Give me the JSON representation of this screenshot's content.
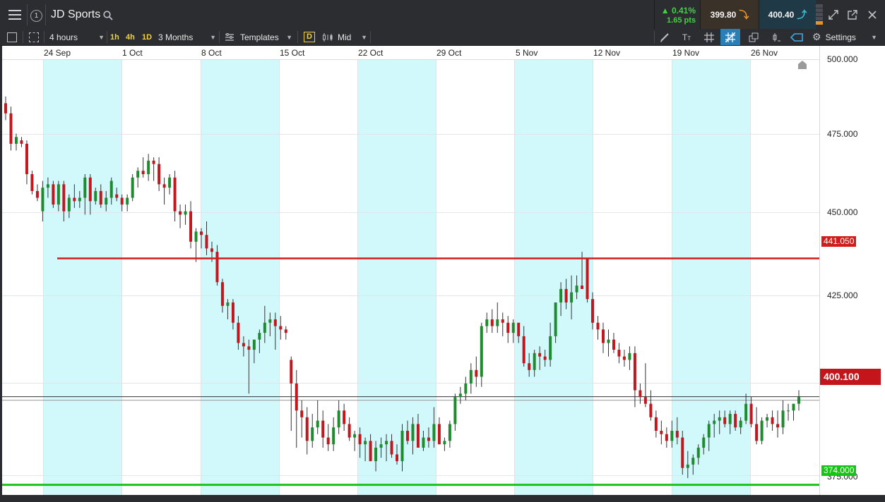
{
  "header": {
    "window_number": "1",
    "title": "JD Sports",
    "change_pct": "▲ 0.41%",
    "change_pts": "1.65 pts",
    "sell_price": "399.80",
    "buy_price": "400.40"
  },
  "toolbar": {
    "interval": "4 hours",
    "quick_intervals": [
      "1h",
      "4h",
      "1D"
    ],
    "range": "3 Months",
    "templates": "Templates",
    "d_badge": "D",
    "price_mode": "Mid",
    "settings": "Settings"
  },
  "chart": {
    "x_labels": [
      "24 Sep",
      "1 Oct",
      "8 Oct",
      "15 Oct",
      "22 Oct",
      "29 Oct",
      "5 Nov",
      "12 Nov",
      "19 Nov",
      "26 Nov"
    ],
    "y_labels": [
      "500.000",
      "475.000",
      "450.000",
      "425.000",
      "375.000"
    ],
    "y_label_values": [
      500,
      475,
      450,
      425,
      375
    ],
    "resistance_label": "441.050",
    "resistance_value": 441.05,
    "support_label": "374.000",
    "support_value": 374.0,
    "current_label": "400.100",
    "current_value": 400.1,
    "colors": {
      "resistance": "#d21b1b",
      "support": "#16c416",
      "up_candle": "#1e8c2e",
      "down_candle": "#c0181e",
      "shade": "#d1f8fb"
    }
  },
  "chart_data": {
    "type": "candlestick",
    "title": "JD Sports",
    "interval": "4 hours",
    "ylim": [
      371,
      504
    ],
    "candles": [
      [
        487,
        489,
        482,
        484
      ],
      [
        484,
        486,
        473,
        475
      ],
      [
        475,
        478,
        473,
        477
      ],
      [
        476,
        477,
        474,
        475
      ],
      [
        475,
        476,
        463,
        466
      ],
      [
        466,
        467,
        460,
        461
      ],
      [
        461,
        463,
        458,
        459
      ],
      [
        455,
        464,
        452,
        462
      ],
      [
        462,
        465,
        459,
        463
      ],
      [
        463,
        464,
        456,
        457
      ],
      [
        457,
        464,
        455,
        463
      ],
      [
        463,
        464,
        452,
        455
      ],
      [
        455,
        460,
        453,
        459
      ],
      [
        459,
        463,
        456,
        458
      ],
      [
        458,
        461,
        456,
        459
      ],
      [
        459,
        466,
        454,
        465
      ],
      [
        465,
        466,
        454,
        458
      ],
      [
        458,
        462,
        457,
        461
      ],
      [
        461,
        463,
        456,
        457
      ],
      [
        457,
        461,
        455,
        459
      ],
      [
        459,
        465,
        457,
        464
      ],
      [
        460,
        462,
        458,
        459
      ],
      [
        459,
        460,
        455,
        457
      ],
      [
        457,
        460,
        455,
        459
      ],
      [
        459,
        466,
        458,
        465
      ],
      [
        465,
        468,
        462,
        467
      ],
      [
        467,
        471,
        465,
        466
      ],
      [
        466,
        472,
        464,
        470
      ],
      [
        470,
        471,
        464,
        469
      ],
      [
        469,
        471,
        461,
        463
      ],
      [
        463,
        465,
        457,
        462
      ],
      [
        462,
        466,
        460,
        465
      ],
      [
        465,
        467,
        452,
        455
      ],
      [
        455,
        457,
        450,
        454
      ],
      [
        454,
        457,
        451,
        455
      ],
      [
        455,
        458,
        444,
        446
      ],
      [
        446,
        450,
        440,
        449
      ],
      [
        449,
        450,
        444,
        448
      ],
      [
        448,
        452,
        442,
        444
      ],
      [
        444,
        446,
        440,
        443
      ],
      [
        443,
        445,
        433,
        434
      ],
      [
        434,
        435,
        425,
        427
      ],
      [
        427,
        429,
        423,
        428
      ],
      [
        428,
        429,
        420,
        422
      ],
      [
        422,
        424,
        414,
        416
      ],
      [
        416,
        418,
        412,
        415
      ],
      [
        415,
        417,
        401,
        414
      ],
      [
        414,
        416,
        410,
        417
      ],
      [
        417,
        420,
        413,
        419
      ],
      [
        419,
        427,
        416,
        422
      ],
      [
        422,
        425,
        418,
        423
      ],
      [
        423,
        425,
        414,
        421
      ],
      [
        421,
        424,
        417,
        420
      ],
      [
        420,
        421,
        417,
        419
      ],
      [
        411,
        412,
        390,
        404
      ],
      [
        404,
        408,
        385,
        396
      ],
      [
        396,
        399,
        388,
        394
      ],
      [
        394,
        397,
        383,
        387
      ],
      [
        387,
        395,
        385,
        391
      ],
      [
        391,
        399,
        389,
        393
      ],
      [
        393,
        396,
        385,
        388
      ],
      [
        388,
        392,
        384,
        386
      ],
      [
        386,
        394,
        384,
        391
      ],
      [
        391,
        399,
        389,
        396
      ],
      [
        396,
        398,
        390,
        392
      ],
      [
        392,
        394,
        387,
        388
      ],
      [
        388,
        390,
        384,
        389
      ],
      [
        389,
        391,
        382,
        386
      ],
      [
        386,
        388,
        381,
        387
      ],
      [
        387,
        389,
        381,
        381
      ],
      [
        381,
        387,
        378,
        385
      ],
      [
        385,
        388,
        382,
        386
      ],
      [
        386,
        389,
        381,
        387
      ],
      [
        387,
        389,
        382,
        383
      ],
      [
        383,
        386,
        380,
        381
      ],
      [
        381,
        392,
        378,
        390
      ],
      [
        390,
        393,
        386,
        387
      ],
      [
        387,
        394,
        383,
        392
      ],
      [
        392,
        395,
        386,
        385
      ],
      [
        385,
        390,
        384,
        388
      ],
      [
        388,
        391,
        385,
        387
      ],
      [
        387,
        397,
        385,
        392
      ],
      [
        392,
        394,
        386,
        386
      ],
      [
        386,
        388,
        384,
        387
      ],
      [
        387,
        393,
        385,
        392
      ],
      [
        392,
        401,
        390,
        400
      ],
      [
        400,
        403,
        398,
        401
      ],
      [
        401,
        406,
        399,
        404
      ],
      [
        404,
        410,
        401,
        408
      ],
      [
        408,
        412,
        403,
        406
      ],
      [
        406,
        422,
        403,
        421
      ],
      [
        421,
        425,
        419,
        423
      ],
      [
        423,
        426,
        419,
        421
      ],
      [
        421,
        428,
        419,
        423
      ],
      [
        423,
        425,
        418,
        422
      ],
      [
        422,
        424,
        416,
        419
      ],
      [
        419,
        423,
        416,
        422
      ],
      [
        422,
        421,
        416,
        418
      ],
      [
        418,
        421,
        409,
        410
      ],
      [
        410,
        413,
        406,
        408
      ],
      [
        408,
        414,
        406,
        413
      ],
      [
        413,
        415,
        408,
        412
      ],
      [
        412,
        414,
        409,
        411
      ],
      [
        411,
        422,
        409,
        418
      ],
      [
        418,
        426,
        416,
        428
      ],
      [
        428,
        434,
        424,
        432
      ],
      [
        432,
        435,
        426,
        428
      ],
      [
        428,
        436,
        423,
        431
      ],
      [
        431,
        436,
        429,
        433
      ],
      [
        433,
        443,
        432,
        432
      ],
      [
        441,
        441,
        428,
        429
      ],
      [
        429,
        431,
        420,
        422
      ],
      [
        422,
        424,
        417,
        420
      ],
      [
        420,
        422,
        413,
        416
      ],
      [
        416,
        420,
        412,
        417
      ],
      [
        417,
        419,
        413,
        414
      ],
      [
        414,
        416,
        410,
        412
      ],
      [
        412,
        414,
        409,
        411
      ],
      [
        411,
        415,
        408,
        413
      ],
      [
        413,
        415,
        397,
        402
      ],
      [
        402,
        404,
        398,
        400
      ],
      [
        400,
        410,
        397,
        398
      ],
      [
        398,
        402,
        393,
        394
      ],
      [
        394,
        396,
        388,
        390
      ],
      [
        390,
        393,
        386,
        389
      ],
      [
        389,
        391,
        385,
        387
      ],
      [
        387,
        393,
        385,
        390
      ],
      [
        390,
        394,
        386,
        388
      ],
      [
        388,
        390,
        377,
        379
      ],
      [
        379,
        384,
        376,
        380
      ],
      [
        380,
        383,
        377,
        382
      ],
      [
        382,
        386,
        380,
        385
      ],
      [
        385,
        389,
        383,
        388
      ],
      [
        388,
        393,
        384,
        392
      ],
      [
        392,
        395,
        388,
        393
      ],
      [
        393,
        396,
        389,
        394
      ],
      [
        394,
        396,
        391,
        392
      ],
      [
        392,
        396,
        389,
        395
      ],
      [
        395,
        396,
        390,
        391
      ],
      [
        391,
        394,
        389,
        393
      ],
      [
        393,
        401,
        392,
        398
      ],
      [
        398,
        400,
        391,
        392
      ],
      [
        392,
        397,
        386,
        387
      ],
      [
        387,
        394,
        386,
        393
      ],
      [
        393,
        395,
        391,
        394
      ],
      [
        394,
        396,
        390,
        392
      ],
      [
        392,
        396,
        388,
        391
      ],
      [
        391,
        399,
        389,
        396
      ],
      [
        396,
        398,
        393,
        396
      ],
      [
        396,
        398,
        393,
        398
      ],
      [
        398,
        402,
        396,
        400
      ]
    ]
  }
}
